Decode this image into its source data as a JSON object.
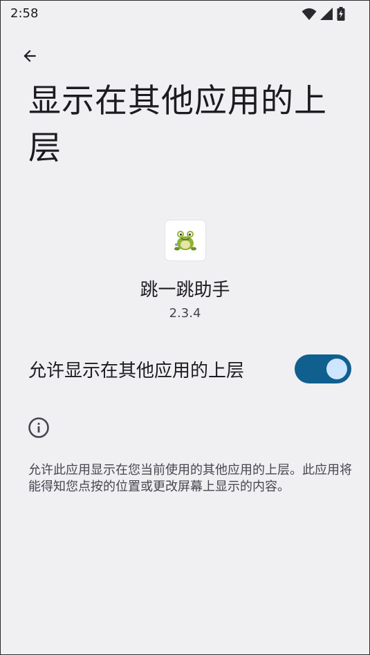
{
  "status_bar": {
    "time": "2:58",
    "icons": [
      "wifi-icon",
      "cell-signal-icon",
      "battery-charging-icon"
    ]
  },
  "header": {
    "back_icon": "arrow-back-icon",
    "title": "显示在其他应用的上层"
  },
  "app": {
    "icon": "frog-app-icon",
    "name": "跳一跳助手",
    "version": "2.3.4"
  },
  "permission": {
    "label": "允许显示在其他应用的上层",
    "enabled": true
  },
  "info": {
    "icon": "info-icon",
    "description": "允许此应用显示在您当前使用的其他应用的上层。此应用将能得知您点按的位置或更改屏幕上显示的内容。"
  },
  "colors": {
    "background": "#f0f0f3",
    "toggle_track": "#0f5f8f",
    "toggle_thumb": "#cde5ff",
    "text_primary": "#1c1b1f",
    "text_secondary": "#45464f"
  }
}
